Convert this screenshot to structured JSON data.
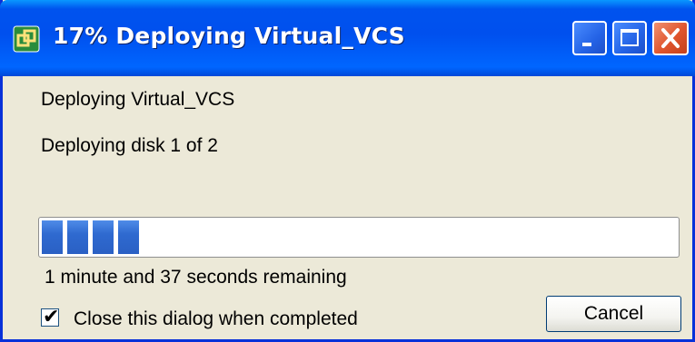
{
  "window": {
    "title": "17% Deploying Virtual_VCS"
  },
  "dialog": {
    "heading": "Deploying Virtual_VCS",
    "status": "Deploying disk 1 of 2",
    "progress_percent": 17,
    "time_remaining": "1 minute and 37 seconds remaining",
    "checkbox": {
      "label": "Close this dialog when completed",
      "checked": true
    },
    "cancel_label": "Cancel"
  },
  "colors": {
    "titlebar": "#0053ee",
    "progress_fill": "#2f6ad0",
    "close_button": "#e0552e",
    "background": "#ece9d8"
  },
  "icons": {
    "app": "vsphere-icon",
    "minimize": "minimize-icon",
    "maximize": "maximize-icon",
    "close": "close-icon",
    "check": "checkmark-icon"
  }
}
